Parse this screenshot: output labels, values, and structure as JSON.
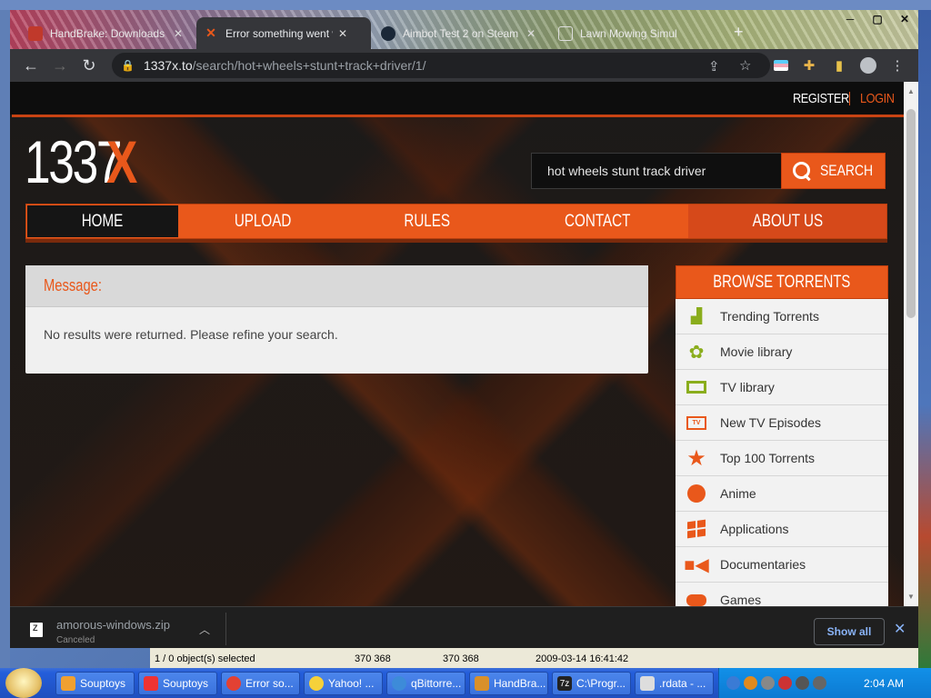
{
  "browser": {
    "tabs": [
      {
        "title": "HandBrake: Downloads",
        "favicon_color": "#c0392b",
        "active": false
      },
      {
        "title": "Error something went wr",
        "favicon_color": "#e9581b",
        "active": true
      },
      {
        "title": "Aimbot Test 2 on Steam",
        "favicon_color": "#1b2838",
        "active": false
      },
      {
        "title": "Lawn Mowing Simul",
        "favicon_color": "#333333",
        "active": false
      }
    ],
    "url_host": "1337x.to",
    "url_path": "/search/hot+wheels+stunt+track+driver/1/"
  },
  "site": {
    "register": "REGISTER",
    "login": "LOGIN",
    "logo_main": "1337",
    "logo_accent": "X",
    "search_value": "hot wheels stunt track driver",
    "search_button": "SEARCH",
    "nav": [
      "HOME",
      "UPLOAD",
      "RULES",
      "CONTACT",
      "ABOUT US"
    ],
    "message_title": "Message:",
    "message_body": "No results were returned. Please refine your search.",
    "browse_title": "BROWSE TORRENTS",
    "browse_items": [
      {
        "label": "Trending Torrents",
        "icon": "trending-icon",
        "color": "#8aad1c"
      },
      {
        "label": "Movie library",
        "icon": "film-reel-icon",
        "color": "#8aad1c"
      },
      {
        "label": "TV library",
        "icon": "tv-icon",
        "color": "#8aad1c"
      },
      {
        "label": "New TV Episodes",
        "icon": "tv-new-icon",
        "color": "#e9581b"
      },
      {
        "label": "Top 100 Torrents",
        "icon": "top-star-icon",
        "color": "#e9581b"
      },
      {
        "label": "Anime",
        "icon": "anime-icon",
        "color": "#e9581b"
      },
      {
        "label": "Applications",
        "icon": "windows-icon",
        "color": "#e9581b"
      },
      {
        "label": "Documentaries",
        "icon": "camera-icon",
        "color": "#e9581b"
      },
      {
        "label": "Games",
        "icon": "gamepad-icon",
        "color": "#e9581b"
      }
    ],
    "accent_color": "#e9581b"
  },
  "downloads": {
    "file": "amorous-windows.zip",
    "status": "Canceled",
    "show_all": "Show all"
  },
  "behind_window": {
    "status": "1 / 0 object(s) selected",
    "size_a": "370 368",
    "size_b": "370 368",
    "date": "2009-03-14 16:41:42"
  },
  "taskbar": {
    "buttons": [
      "Souptoys",
      "Souptoys",
      "Error so...",
      "Yahoo! ...",
      "qBittorre...",
      "HandBra...",
      "C:\\Progr...",
      ".rdata - ..."
    ],
    "clock": "2:04 AM"
  }
}
